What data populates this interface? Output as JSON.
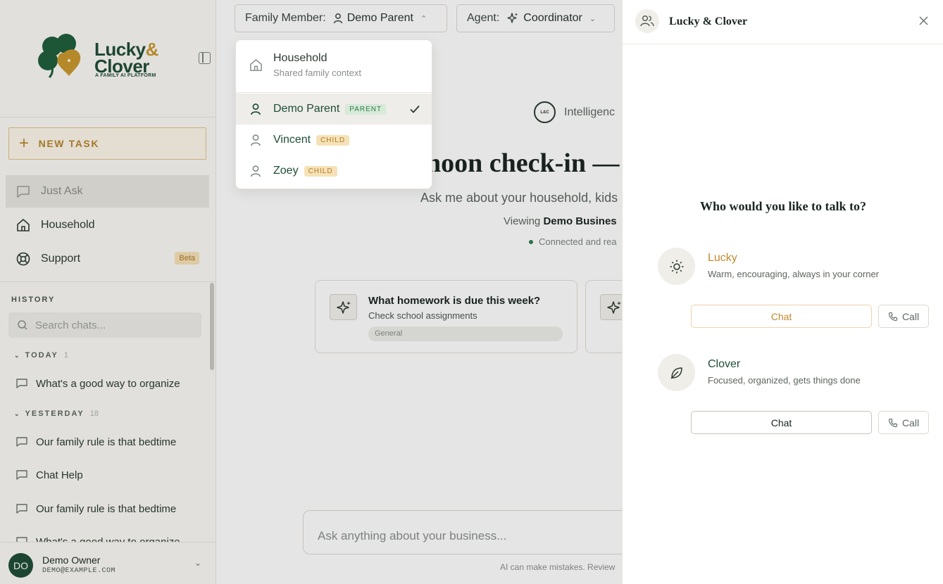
{
  "brand": {
    "name_line1": "Lucky",
    "name_amp": "&",
    "name_line2": "Clover",
    "tagline": "A FAMILY AI PLATFORM"
  },
  "sidebar": {
    "new_task_label": "NEW TASK",
    "nav": [
      {
        "label": "Just Ask",
        "icon": "chat-bubble-icon",
        "active": true
      },
      {
        "label": "Household",
        "icon": "home-icon"
      },
      {
        "label": "Support",
        "icon": "lifebuoy-icon",
        "badge": "Beta"
      }
    ],
    "history_label": "HISTORY",
    "search_placeholder": "Search chats...",
    "groups": [
      {
        "label": "TODAY",
        "count": "1",
        "items": [
          "What's a good way to organize"
        ]
      },
      {
        "label": "YESTERDAY",
        "count": "18",
        "items": [
          "Our family rule is that bedtime",
          "Chat Help",
          "Our family rule is that bedtime",
          "What's a good way to organize"
        ]
      }
    ],
    "user": {
      "initials": "DO",
      "name": "Demo Owner",
      "email": "DEMO@EXAMPLE.COM"
    }
  },
  "topbar": {
    "family_label": "Family Member:",
    "family_value": "Demo Parent",
    "agent_label": "Agent:",
    "agent_value": "Coordinator"
  },
  "family_dropdown": {
    "household": {
      "title": "Household",
      "subtitle": "Shared family context"
    },
    "members": [
      {
        "name": "Demo Parent",
        "role": "PARENT",
        "selected": true
      },
      {
        "name": "Vincent",
        "role": "CHILD",
        "selected": false
      },
      {
        "name": "Zoey",
        "role": "CHILD",
        "selected": false
      }
    ]
  },
  "main": {
    "intel_badge": "L&C",
    "intel_label": "Intelligenc",
    "hero": "noon check-in —",
    "subtitle": "Ask me about your household, kids",
    "viewing_prefix": "Viewing",
    "viewing_name": "Demo Busines",
    "connected": "Connected and rea",
    "cards": [
      {
        "title": "What homework is due this week?",
        "desc": "Check school assignments",
        "tag": "General"
      }
    ],
    "ask_placeholder": "Ask anything about your business...",
    "disclaimer": "AI can make mistakes. Review"
  },
  "panel": {
    "title": "Lucky & Clover",
    "question": "Who would you like to talk to?",
    "agents": [
      {
        "name": "Lucky",
        "desc": "Warm, encouraging, always in your corner",
        "chat_label": "Chat",
        "call_label": "Call",
        "color": "#c08a2f"
      },
      {
        "name": "Clover",
        "desc": "Focused, organized, gets things done",
        "chat_label": "Chat",
        "call_label": "Call",
        "color": "#1f4d36"
      }
    ]
  }
}
